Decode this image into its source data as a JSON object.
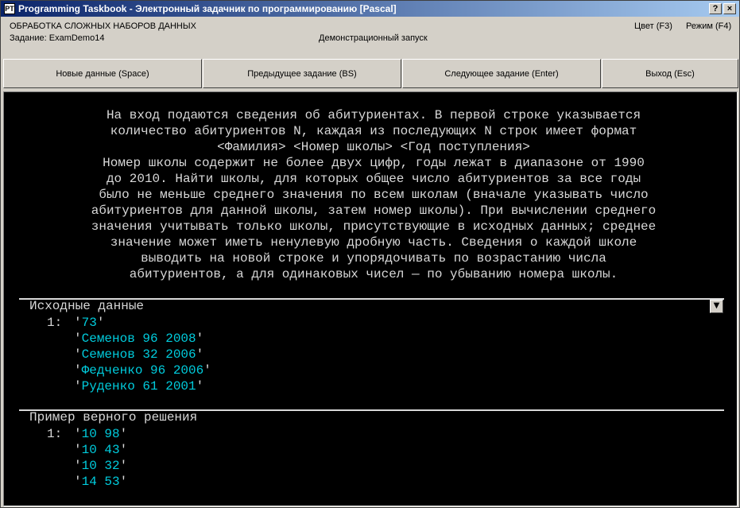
{
  "window": {
    "title": "Programming Taskbook - Электронный задачник по программированию [Pascal]",
    "icon_label": "PT",
    "help_label": "?",
    "close_label": "×"
  },
  "info": {
    "group_title": "ОБРАБОТКА СЛОЖНЫХ НАБОРОВ ДАННЫХ",
    "task_name": "Задание: ExamDemo14",
    "demo_mode": "Демонстрационный запуск",
    "color_menu": "Цвет (F3)",
    "mode_menu": "Режим (F4)"
  },
  "buttons": {
    "new_data": "Новые данные (Space)",
    "prev_task": "Предыдущее задание (BS)",
    "next_task": "Следующее задание (Enter)",
    "exit": "Выход (Esc)"
  },
  "description": [
    "На вход подаются сведения об абитуриентах. В первой строке указывается",
    "количество абитуриентов N, каждая из последующих N строк имеет формат",
    "<Фамилия> <Номер школы> <Год поступления>",
    "Номер школы содержит не более двух цифр, годы лежат в диапазоне от 1990",
    "до 2010. Найти школы, для которых общее число абитуриентов за все годы",
    "было не меньше среднего значения по всем школам (вначале указывать число",
    "абитуриентов для данной школы, затем номер школы). При вычислении среднего",
    "значения учитывать только школы, присутствующие в исходных данных; среднее",
    "значение может иметь ненулевую дробную часть. Сведения о каждой школе",
    "выводить на новой строке и упорядочивать по возрастанию числа",
    "абитуриентов, а для одинаковых чисел — по убыванию номера школы."
  ],
  "input_section": {
    "title": "Исходные данные",
    "filter_icon": "▼",
    "line_number": "1:",
    "quote": "'",
    "lines": [
      "73",
      "Семенов 96 2008",
      "Семенов 32 2006",
      "Федченко 96 2006",
      "Руденко 61 2001"
    ]
  },
  "output_section": {
    "title": "Пример верного решения",
    "line_number": "1:",
    "quote": "'",
    "lines": [
      "10 98",
      "10 43",
      "10 32",
      "14 53"
    ]
  },
  "colors": {
    "title_bar_start": "#0a246a",
    "console_bg": "#000000",
    "console_text": "#d8d8d8",
    "data_value": "#00ccdd"
  }
}
